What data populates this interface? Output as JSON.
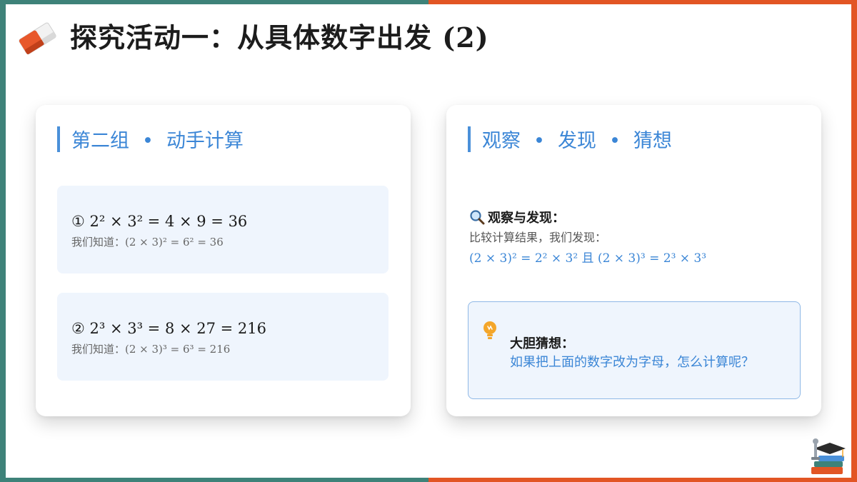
{
  "header": {
    "title": "探究活动一：从具体数字出发 (2)",
    "icon": "eraser-icon"
  },
  "colors": {
    "teal": "#3e8279",
    "orange": "#e25524",
    "accent_blue": "#3b86d6",
    "box_bg": "#eff5fd"
  },
  "left_card": {
    "heading_part1": "第二组",
    "heading_dot": "•",
    "heading_part2": "动手计算",
    "calcs": [
      {
        "main": "① 2² × 3² = 4 × 9 = 36",
        "sub": "我们知道：(2 × 3)² = 6² = 36"
      },
      {
        "main": "② 2³ × 3³ = 8 × 27 = 216",
        "sub": "我们知道：(2 × 3)³ = 6³ = 216"
      }
    ]
  },
  "right_card": {
    "heading_part1": "观察",
    "heading_dot1": "•",
    "heading_part2": "发现",
    "heading_dot2": "•",
    "heading_part3": "猜想",
    "observe": {
      "icon": "magnifier-icon",
      "title": "观察与发现：",
      "text": "比较计算结果，我们发现：",
      "formula": "(2 × 3)² = 2² × 3² 且 (2 × 3)³ = 2³ × 3³"
    },
    "guess": {
      "icon": "lightbulb-icon",
      "title": "大胆猜想：",
      "text": "如果把上面的数字改为字母，怎么计算呢？"
    }
  }
}
